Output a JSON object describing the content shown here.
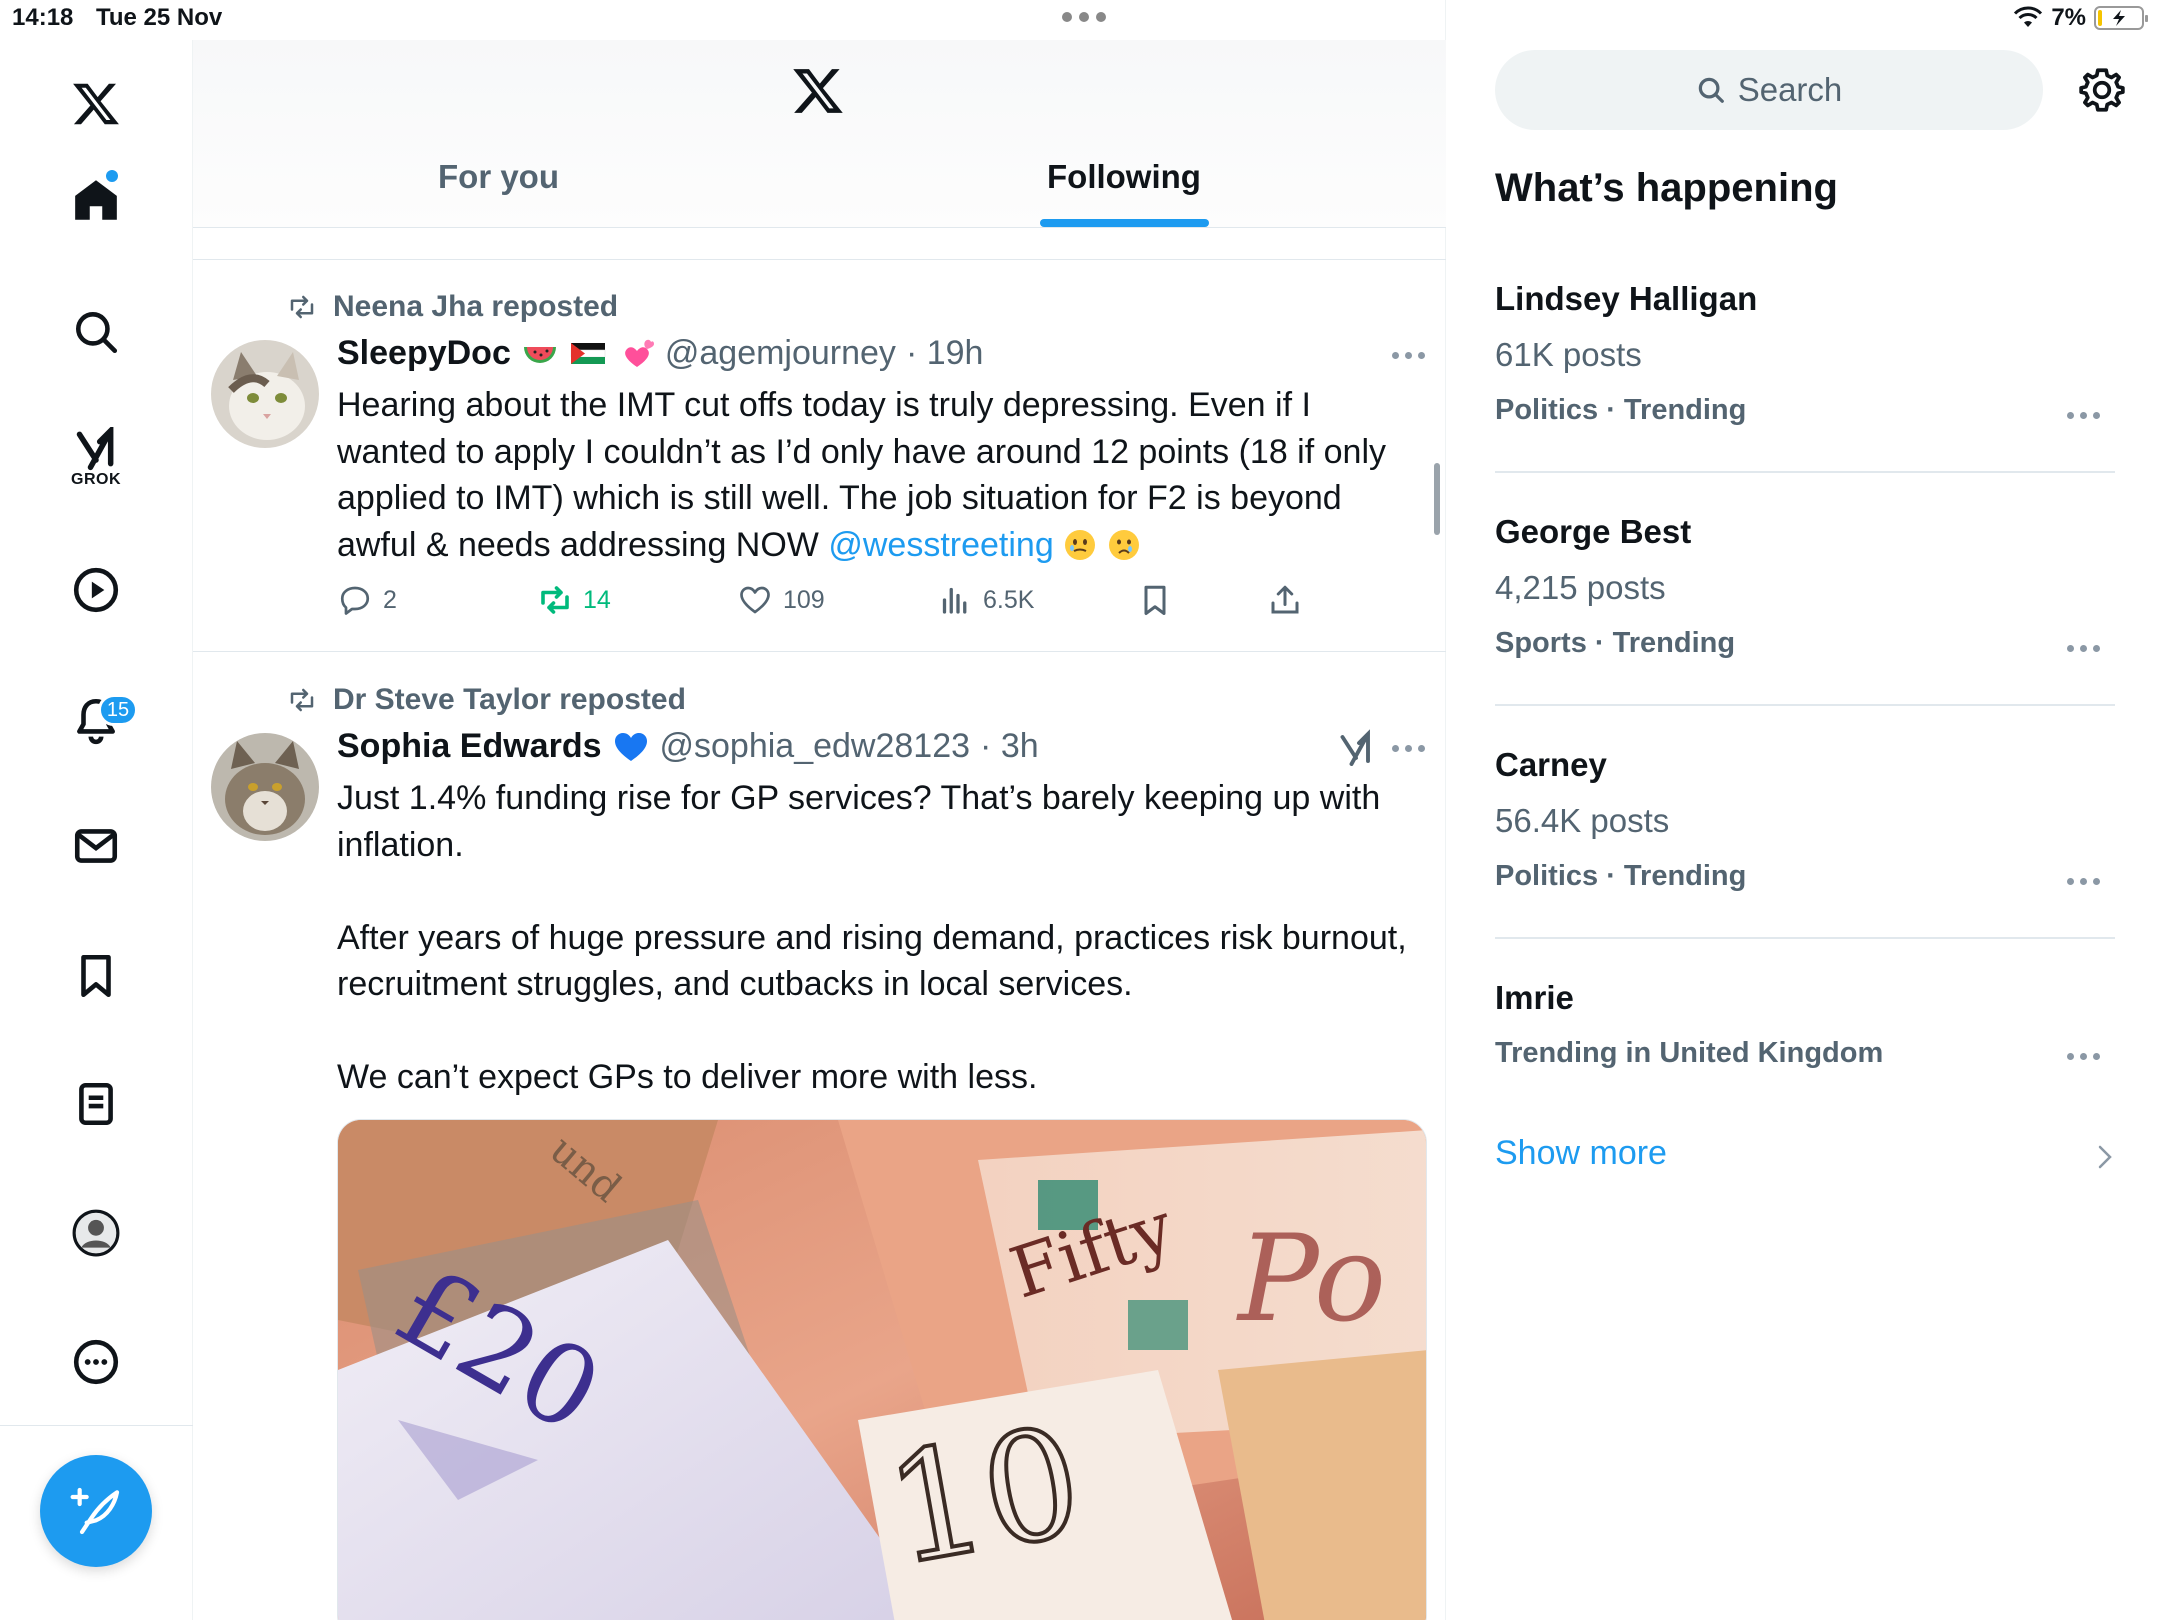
{
  "status": {
    "time": "14:18",
    "date": "Tue 25 Nov",
    "battery": "7%"
  },
  "nav": {
    "notifications_badge": "15",
    "grok_label": "GROK",
    "icons": [
      "x-logo-icon",
      "home-icon",
      "search-icon",
      "grok-icon",
      "video-icon",
      "bell-icon",
      "mail-icon",
      "bookmark-icon",
      "list-icon",
      "profile-icon",
      "more-icon"
    ]
  },
  "header": {
    "tabs": [
      {
        "label": "For you",
        "selected": false
      },
      {
        "label": "Following",
        "selected": true
      }
    ]
  },
  "tweets": [
    {
      "repost_by": "Neena Jha reposted",
      "name": "SleepyDoc",
      "name_emojis": [
        "watermelon",
        "palestine-flag",
        "two-hearts"
      ],
      "handle": "@agemjourney",
      "time": "· 19h",
      "text": "Hearing about the IMT cut offs today is truly depressing. Even if I wanted to apply I couldn’t as I’d only have around 12 points (18 if only applied to IMT) which is still well. The job situation for F2 is beyond awful & needs addressing NOW ",
      "mention": "@wesstreeting",
      "text_emojis": [
        "face-holding-back-tears",
        "crying-face"
      ],
      "replies": "2",
      "reposts": "14",
      "likes": "109",
      "views": "6.5K"
    },
    {
      "repost_by": "Dr Steve Taylor reposted",
      "name": "Sophia Edwards",
      "name_emojis": [
        "blue-heart"
      ],
      "handle": "@sophia_edw28123",
      "time": "· 3h",
      "text": "Just 1.4% funding rise for GP services? That’s barely keeping up with inflation.\n\nAfter years of huge pressure and rising demand, practices risk burnout, recruitment struggles, and cutbacks in local services.\n\nWe can’t expect GPs to deliver more with less.",
      "image_note_lettering": [
        "£20",
        "10",
        "Fifty"
      ]
    }
  ],
  "sidebar": {
    "search_placeholder": "Search",
    "title": "What’s happening",
    "trends": [
      {
        "name": "Lindsey Halligan",
        "count": "61K posts",
        "category": "Politics · Trending"
      },
      {
        "name": "George Best",
        "count": "4,215 posts",
        "category": "Sports · Trending"
      },
      {
        "name": "Carney",
        "count": "56.4K posts",
        "category": "Politics · Trending"
      },
      {
        "name": "Imrie",
        "count": "",
        "category": "Trending in United Kingdom"
      }
    ],
    "show_more": "Show more"
  },
  "colors": {
    "accent": "#1d9bf0",
    "repost_green": "#00ba7c",
    "muted": "#536471"
  }
}
